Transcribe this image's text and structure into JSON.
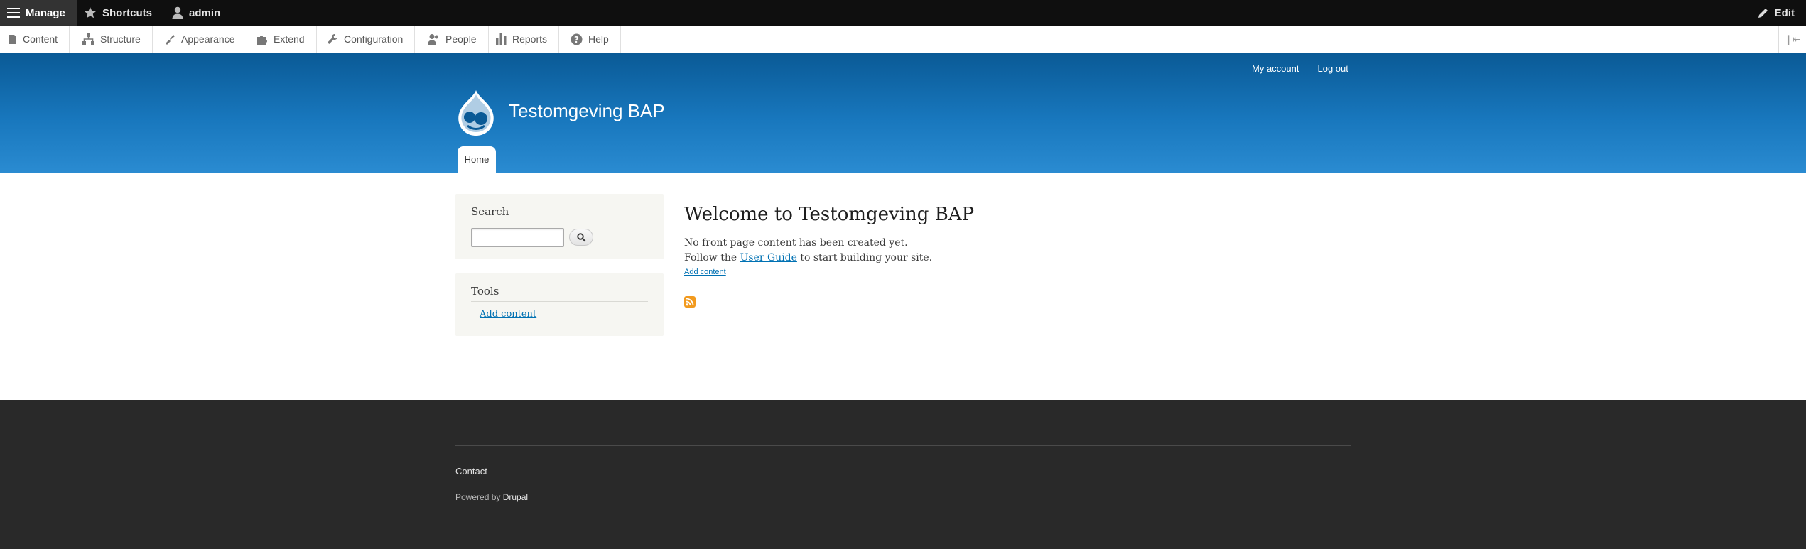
{
  "toolbar": {
    "manage_label": "Manage",
    "shortcuts_label": "Shortcuts",
    "user_label": "admin",
    "edit_label": "Edit"
  },
  "tray": {
    "items": [
      {
        "label": "Content",
        "icon": "file-icon"
      },
      {
        "label": "Structure",
        "icon": "sitemap-icon"
      },
      {
        "label": "Appearance",
        "icon": "brush-icon"
      },
      {
        "label": "Extend",
        "icon": "puzzle-icon"
      },
      {
        "label": "Configuration",
        "icon": "wrench-icon"
      },
      {
        "label": "People",
        "icon": "people-icon"
      },
      {
        "label": "Reports",
        "icon": "bar-chart-icon"
      },
      {
        "label": "Help",
        "icon": "help-icon"
      }
    ]
  },
  "header": {
    "secondary_menu": [
      "My account",
      "Log out"
    ],
    "site_name": "Testomgeving BAP",
    "main_menu": [
      "Home"
    ]
  },
  "sidebar": {
    "search": {
      "title": "Search",
      "input_value": ""
    },
    "tools": {
      "title": "Tools",
      "links": [
        "Add content"
      ]
    }
  },
  "main": {
    "title": "Welcome to Testomgeving BAP",
    "para1": "No front page content has been created yet.",
    "para2_before": "Follow the ",
    "para2_link": "User Guide",
    "para2_after": " to start building your site.",
    "add_content": "Add content"
  },
  "footer": {
    "contact": "Contact",
    "powered_prefix": "Powered by ",
    "powered_link": "Drupal"
  },
  "colors": {
    "toolbar_bg": "#0f0f0f",
    "header_gradient_top": "#0a5a96",
    "header_gradient_bottom": "#2a8bd1",
    "link": "#0071b3",
    "footer_bg": "#292929",
    "sidebar_bg": "#f6f6f2"
  }
}
